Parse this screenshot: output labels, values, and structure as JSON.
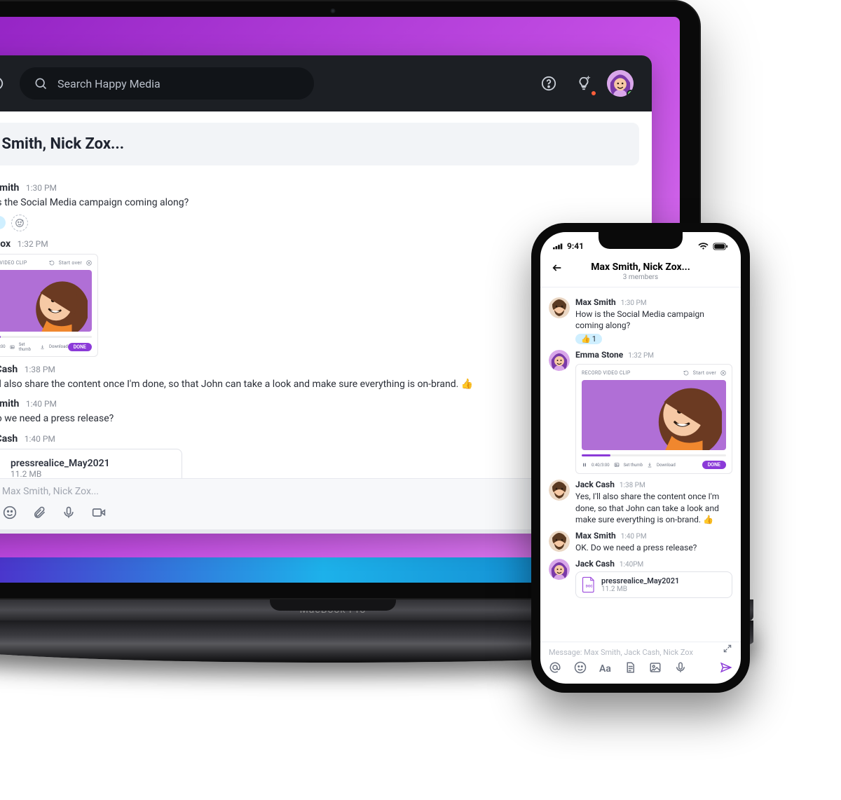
{
  "laptop_brand": "MacBook Pro",
  "search": {
    "placeholder": "Search Happy Media"
  },
  "channel_title": "ax Smith, Nick Zox...",
  "reaction": {
    "emoji": "👍",
    "count": "1"
  },
  "clip": {
    "heading": "RECORD VIDEO CLIP",
    "startover": "Start over",
    "timer": "0:40/3:00",
    "setthumb": "Set thumb",
    "download": "Download",
    "done": "DONE"
  },
  "file": {
    "name": "pressrealice_May2021",
    "size": "11.2 MB"
  },
  "composer": {
    "placeholder": "ssage Max Smith, Nick Zox..."
  },
  "messages": [
    {
      "who": "Max Smith",
      "when": "1:30 PM",
      "body": "How is the Social Media campaign coming along?"
    },
    {
      "who": "Nick Zox",
      "when": "1:32 PM"
    },
    {
      "who": "Jack Cash",
      "when": "1:38 PM",
      "body": "Yes, I'll also share the content once I'm done, so that John can take a look and make sure everything is on-brand. 👍"
    },
    {
      "who": "Max Smith",
      "when": "1:40 PM",
      "body": "OK. Do we need a press release?"
    },
    {
      "who": "Jack Cash",
      "when": "1:40 PM"
    }
  ],
  "phone": {
    "time": "9:41",
    "title": "Max Smith, Nick Zox...",
    "subtitle": "3 members",
    "composer_placeholder": "Message: Max Smith, Jack Cash, Nick Zox",
    "messages": [
      {
        "who": "Max Smith",
        "when": "1:30 PM",
        "body": "How is the Social Media campaign coming along?"
      },
      {
        "who": "Emma Stone",
        "when": "1:32 PM"
      },
      {
        "who": "Jack Cash",
        "when": "1:38 PM",
        "body": "Yes, I'll also share the content once I'm done, so that John can take a look and make sure everything is on-brand. 👍"
      },
      {
        "who": "Max Smith",
        "when": "1:40 PM",
        "body": "OK. Do we need a press release?"
      },
      {
        "who": "Jack Cash",
        "when": "1:40PM"
      }
    ]
  }
}
